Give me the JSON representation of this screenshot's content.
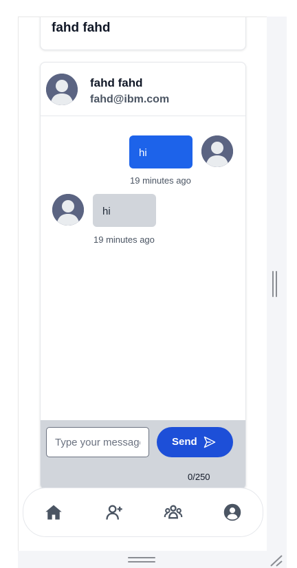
{
  "profile_card": {
    "name": "fahd fahd"
  },
  "chat": {
    "contact": {
      "name": "fahd fahd",
      "email": "fahd@ibm.com"
    },
    "messages": [
      {
        "direction": "outgoing",
        "text": "hi",
        "time": "19 minutes ago"
      },
      {
        "direction": "incoming",
        "text": "hi",
        "time": "19 minutes ago"
      }
    ],
    "composer": {
      "placeholder": "Type your message",
      "send_label": "Send",
      "char_count": "0/250"
    }
  },
  "bottom_nav": {
    "items": [
      {
        "icon": "home-icon"
      },
      {
        "icon": "add-user-icon"
      },
      {
        "icon": "group-icon"
      },
      {
        "icon": "account-icon"
      }
    ]
  },
  "colors": {
    "primary": "#1d4fd8",
    "outgoing_bubble": "#1d63ea",
    "incoming_bubble": "#d1d5db",
    "nav_icon": "#4b5563"
  }
}
